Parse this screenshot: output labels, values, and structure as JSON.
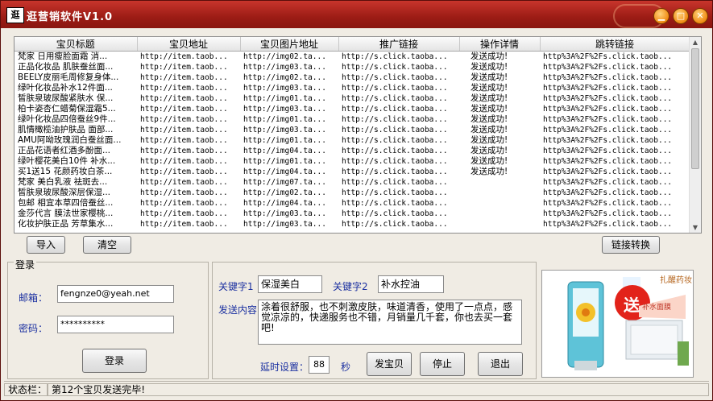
{
  "window": {
    "title": "逛营销软件V1.0",
    "logo_text": "逛"
  },
  "table": {
    "headers": [
      "宝贝标题",
      "宝贝地址",
      "宝贝图片地址",
      "推广链接",
      "操作详情",
      "跳转链接"
    ],
    "rows": [
      [
        "梵家 日用瘦脸面霜 消...",
        "http://item.taob...",
        "http://img02.ta...",
        "http://s.click.taoba...",
        "发送成功!",
        "http%3A%2F%2Fs.click.taob..."
      ],
      [
        "正品化妆品 肌肤蚕丝面...",
        "http://item.taob...",
        "http://img03.ta...",
        "http://s.click.taoba...",
        "发送成功!",
        "http%3A%2F%2Fs.click.taob..."
      ],
      [
        "BEELY皮丽毛周修复身体...",
        "http://item.taob...",
        "http://img02.ta...",
        "http://s.click.taoba...",
        "发送成功!",
        "http%3A%2F%2Fs.click.taob..."
      ],
      [
        "绿叶化妆品补水12件面...",
        "http://item.taob...",
        "http://img03.ta...",
        "http://s.click.taoba...",
        "发送成功!",
        "http%3A%2F%2Fs.click.taob..."
      ],
      [
        "皙肤泉玻尿酸紧肤水 保...",
        "http://item.taob...",
        "http://img01.ta...",
        "http://s.click.taoba...",
        "发送成功!",
        "http%3A%2F%2Fs.click.taob..."
      ],
      [
        "柏卡姿杏仁蜡菊保湿霜5...",
        "http://item.taob...",
        "http://img03.ta...",
        "http://s.click.taoba...",
        "发送成功!",
        "http%3A%2F%2Fs.click.taob..."
      ],
      [
        "绿叶化妆品四倍蚕丝9件...",
        "http://item.taob...",
        "http://img01.ta...",
        "http://s.click.taoba...",
        "发送成功!",
        "http%3A%2F%2Fs.click.taob..."
      ],
      [
        "肌情橄榄油护肤品 面部...",
        "http://item.taob...",
        "http://img03.ta...",
        "http://s.click.taoba...",
        "发送成功!",
        "http%3A%2F%2Fs.click.taob..."
      ],
      [
        "AMU阿呦玫瑰润白蚕丝面...",
        "http://item.taob...",
        "http://img01.ta...",
        "http://s.click.taoba...",
        "发送成功!",
        "http%3A%2F%2Fs.click.taob..."
      ],
      [
        "正品花语者红酒多酚面...",
        "http://item.taob...",
        "http://img04.ta...",
        "http://s.click.taoba...",
        "发送成功!",
        "http%3A%2F%2Fs.click.taob..."
      ],
      [
        "绿叶樱花美白10件 补水...",
        "http://item.taob...",
        "http://img01.ta...",
        "http://s.click.taoba...",
        "发送成功!",
        "http%3A%2F%2Fs.click.taob..."
      ],
      [
        "买1送15 花颜药妆白茶...",
        "http://item.taob...",
        "http://img04.ta...",
        "http://s.click.taoba...",
        "发送成功!",
        "http%3A%2F%2Fs.click.taob..."
      ],
      [
        "梵家 美白乳液 祛斑去...",
        "http://item.taob...",
        "http://img07.ta...",
        "http://s.click.taoba...",
        "",
        "http%3A%2F%2Fs.click.taob..."
      ],
      [
        "皙肤泉玻尿酸深层保湿...",
        "http://item.taob...",
        "http://img02.ta...",
        "http://s.click.taoba...",
        "",
        "http%3A%2F%2Fs.click.taob..."
      ],
      [
        "包邮 相宜本草四倍蚕丝...",
        "http://item.taob...",
        "http://img04.ta...",
        "http://s.click.taoba...",
        "",
        "http%3A%2F%2Fs.click.taob..."
      ],
      [
        "金莎代言 膜法世家樱桃...",
        "http://item.taob...",
        "http://img03.ta...",
        "http://s.click.taoba...",
        "",
        "http%3A%2F%2Fs.click.taob..."
      ],
      [
        "化妆护肤正品 芳草集水...",
        "http://item.taob...",
        "http://img03.ta...",
        "http://s.click.taoba...",
        "",
        "http%3A%2F%2Fs.click.taob..."
      ]
    ]
  },
  "buttons": {
    "import": "导入",
    "clear": "清空",
    "convert": "链接转换",
    "login": "登录",
    "send": "发宝贝",
    "stop": "停止",
    "exit": "退出"
  },
  "login": {
    "group_label": "登录",
    "email_label": "邮箱：",
    "email_value": "fengnze0@yeah.net",
    "password_label": "密码：",
    "password_value": "**********"
  },
  "send": {
    "keyword1_label": "关键字1",
    "keyword1_value": "保湿美白",
    "keyword2_label": "关键字2",
    "keyword2_value": "补水控油",
    "content_label": "发送内容",
    "content_value": "涂着很舒服，也不刺激皮肤，味道清香，使用了一点点，感觉凉凉的，快递服务也不错，月销量几千套，你也去买一套吧!",
    "delay_label": "延时设置：",
    "delay_value": "88",
    "delay_unit": "秒"
  },
  "ad": {
    "banner_text": "扎醒药妆",
    "promo_text": "送",
    "product_text": "补水面膜"
  },
  "status": {
    "label": "状态栏：",
    "message": "第12个宝贝发送完毕!"
  }
}
